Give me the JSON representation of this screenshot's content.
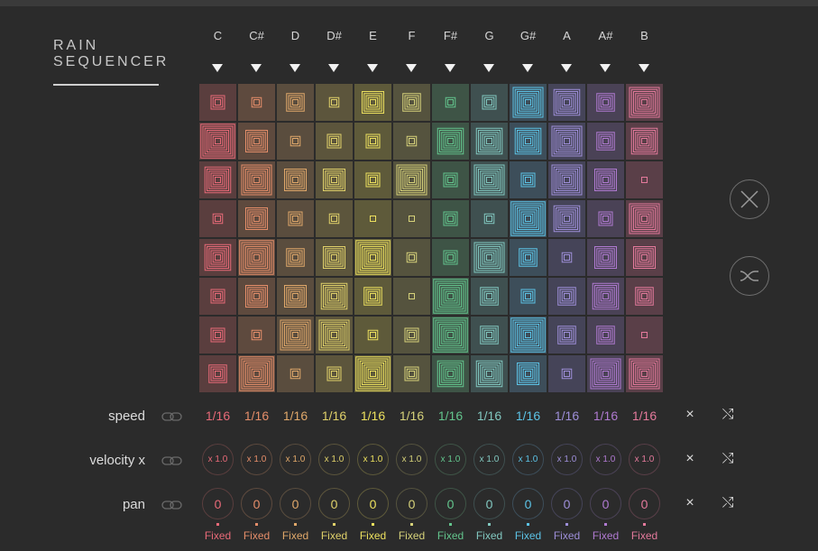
{
  "app": {
    "title_line1": "RAIN",
    "title_line2": "SEQUENCER"
  },
  "notes": [
    "C",
    "C#",
    "D",
    "D#",
    "E",
    "F",
    "F#",
    "G",
    "G#",
    "A",
    "A#",
    "B"
  ],
  "colors": {
    "note_colors": [
      "#e86a78",
      "#e58e6a",
      "#e0a86a",
      "#e0d16a",
      "#ece05e",
      "#d6d27a",
      "#63c58d",
      "#82c8c0",
      "#5cc3e6",
      "#9e8fd9",
      "#b07ad1",
      "#e47a9c"
    ],
    "cell_bgs": [
      "#5a3e3e",
      "#5e4a3e",
      "#5a4d3e",
      "#5c553c",
      "#5e5a3a",
      "#55533e",
      "#3e5446",
      "#3f5050",
      "#3d4e5a",
      "#454458",
      "#4a4256",
      "#5a3f48"
    ],
    "background": "#2b2b2b"
  },
  "grid_levels": [
    [
      2,
      1,
      3,
      1,
      4,
      3,
      1,
      2,
      6,
      5,
      3,
      6
    ],
    [
      7,
      4,
      1,
      2,
      2,
      1,
      5,
      5,
      5,
      6,
      3,
      5
    ],
    [
      5,
      6,
      4,
      4,
      2,
      6,
      2,
      6,
      2,
      6,
      4,
      0
    ],
    [
      1,
      4,
      2,
      1,
      0,
      0,
      2,
      1,
      7,
      5,
      2,
      6
    ],
    [
      5,
      7,
      3,
      4,
      8,
      1,
      2,
      6,
      3,
      1,
      4,
      4
    ],
    [
      2,
      4,
      4,
      5,
      3,
      0,
      7,
      3,
      2,
      3,
      5,
      3
    ],
    [
      2,
      1,
      6,
      6,
      1,
      2,
      7,
      3,
      7,
      3,
      3,
      0
    ],
    [
      3,
      7,
      1,
      2,
      8,
      2,
      5,
      5,
      4,
      1,
      6,
      6
    ]
  ],
  "controls": {
    "clear_icon": "close-circle-icon",
    "shuffle_icon": "shuffle-circle-icon"
  },
  "rows": {
    "speed": {
      "label": "speed",
      "values": [
        "1/16",
        "1/16",
        "1/16",
        "1/16",
        "1/16",
        "1/16",
        "1/16",
        "1/16",
        "1/16",
        "1/16",
        "1/16",
        "1/16"
      ]
    },
    "velocity": {
      "label": "velocity x",
      "values": [
        "x 1.0",
        "x 1.0",
        "x 1.0",
        "x 1.0",
        "x 1.0",
        "x 1.0",
        "x 1.0",
        "x 1.0",
        "x 1.0",
        "x 1.0",
        "x 1.0",
        "x 1.0"
      ]
    },
    "pan": {
      "label": "pan",
      "values": [
        "0",
        "0",
        "0",
        "0",
        "0",
        "0",
        "0",
        "0",
        "0",
        "0",
        "0",
        "0"
      ],
      "mode": [
        "Fixed",
        "Fixed",
        "Fixed",
        "Fixed",
        "Fixed",
        "Fixed",
        "Fixed",
        "Fixed",
        "Fixed",
        "Fixed",
        "Fixed",
        "Fixed"
      ]
    }
  },
  "row_buttons": {
    "reset_symbol": "×",
    "shuffle_symbol": "⤭"
  }
}
